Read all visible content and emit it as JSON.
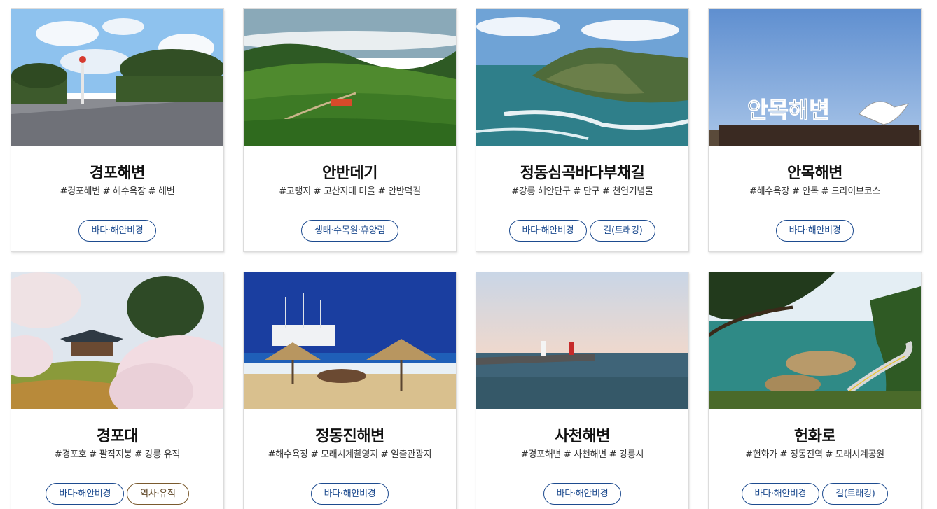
{
  "cards": [
    {
      "title": "경포해변",
      "tags": "#경포해변 # 해수욕장 # 해변",
      "badges": [
        "바다·해안비경"
      ],
      "image": "beach-plaza-pines"
    },
    {
      "title": "안반데기",
      "tags": "#고랭지 # 고산지대 마을 # 안반덕길",
      "badges": [
        "생태·수목원·휴양림"
      ],
      "image": "highland-cabbage-fields"
    },
    {
      "title": "정동심곡바다부채길",
      "tags": "#강릉 해안단구 # 단구 # 천연기념물",
      "badges": [
        "바다·해안비경",
        "길(트래킹)"
      ],
      "image": "coastal-cliffs"
    },
    {
      "title": "안목해변",
      "tags": "#해수욕장 # 안목 # 드라이브코스",
      "badges": [
        "바다·해안비경"
      ],
      "image": "anmok-beach-sign"
    },
    {
      "title": "경포대",
      "tags": "#경포호 # 팔작지붕 # 강릉 유적",
      "badges": [
        "바다·해안비경",
        "역사·유적"
      ],
      "image": "pavilion-cherry-blossoms"
    },
    {
      "title": "정동진해변",
      "tags": "#해수욕장 # 모래시계촬영지 # 일출관광지",
      "badges": [
        "바다·해안비경"
      ],
      "image": "ship-beach-parasols"
    },
    {
      "title": "사천해변",
      "tags": "#경포해변 # 사천해변 # 강릉시",
      "badges": [
        "바다·해안비경"
      ],
      "image": "lighthouses-breakwater"
    },
    {
      "title": "헌화로",
      "tags": "#헌화가 # 정동진역 # 모래시계공원",
      "badges": [
        "바다·해안비경",
        "길(트래킹)"
      ],
      "image": "coastal-road-pine"
    }
  ],
  "anmok_sign_text": "안목해변",
  "colors": {
    "badge_border": "#1d4b8f",
    "history_badge_border": "#7a5a2e"
  }
}
